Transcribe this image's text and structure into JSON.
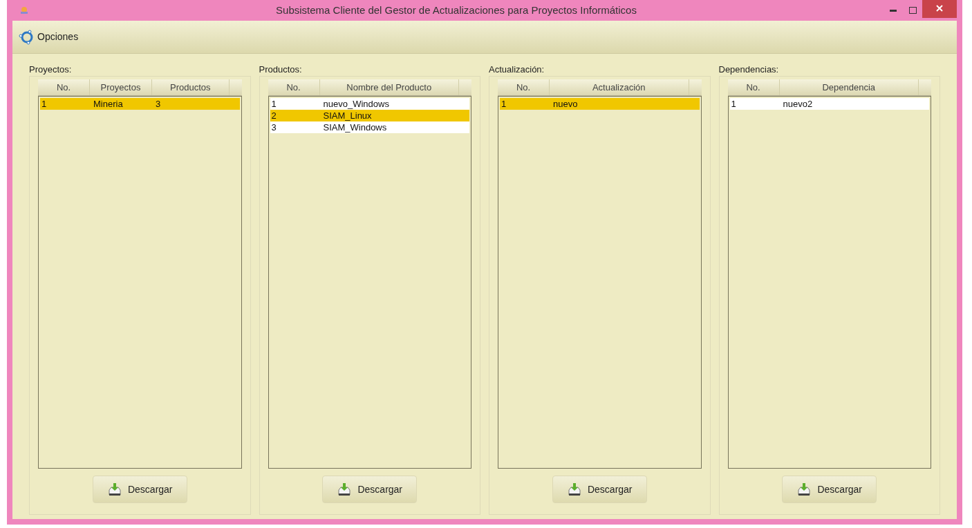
{
  "window": {
    "title": "Subsistema Cliente del Gestor de Actualizaciones para Proyectos Informáticos"
  },
  "menu": [
    {
      "label": "Opciones"
    }
  ],
  "panels": [
    {
      "title": "Proyectos:",
      "columns": [
        "No.",
        "Proyectos",
        "Productos"
      ],
      "rows": [
        {
          "cells": [
            "1",
            "Mineria",
            "3"
          ],
          "selected": true
        }
      ],
      "button": "Descargar"
    },
    {
      "title": "Productos:",
      "columns": [
        "No.",
        "Nombre del Producto"
      ],
      "rows": [
        {
          "cells": [
            "1",
            "nuevo_Windows"
          ],
          "selected": false
        },
        {
          "cells": [
            "2",
            "SIAM_Linux"
          ],
          "selected": true
        },
        {
          "cells": [
            "3",
            "SIAM_Windows"
          ],
          "selected": false
        }
      ],
      "button": "Descargar"
    },
    {
      "title": "Actualización:",
      "columns": [
        "No.",
        "Actualización"
      ],
      "rows": [
        {
          "cells": [
            "1",
            "nuevo"
          ],
          "selected": true
        }
      ],
      "button": "Descargar"
    },
    {
      "title": "Dependencias:",
      "columns": [
        "No.",
        "Dependencia"
      ],
      "rows": [
        {
          "cells": [
            "1",
            "nuevo2"
          ],
          "selected": false
        }
      ],
      "button": "Descargar"
    }
  ]
}
